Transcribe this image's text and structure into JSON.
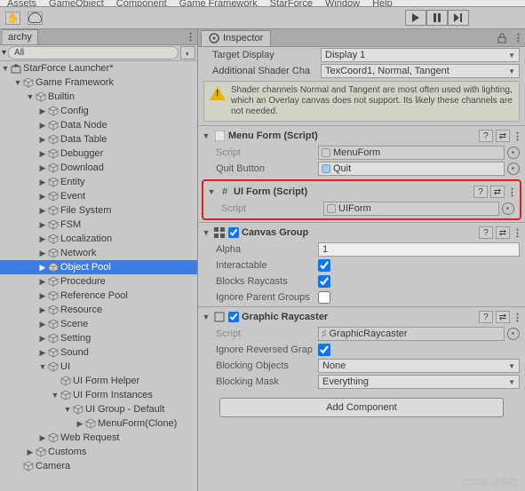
{
  "menubar": [
    "Assets",
    "GameObject",
    "Component",
    "Game Framework",
    "StarForce",
    "Window",
    "Help"
  ],
  "hierarchy": {
    "tab": "archy",
    "search": "All",
    "root": "StarForce Launcher*",
    "gf": "Game Framework",
    "builtin": "Builtin",
    "items": [
      "Config",
      "Data Node",
      "Data Table",
      "Debugger",
      "Download",
      "Entity",
      "Event",
      "File System",
      "FSM",
      "Localization",
      "Network",
      "Object Pool",
      "Procedure",
      "Reference Pool",
      "Resource",
      "Scene",
      "Setting",
      "Sound",
      "UI"
    ],
    "ui_children": [
      "UI Form Helper",
      "UI Form Instances"
    ],
    "ui_group": "UI Group - Default",
    "menu_clone": "MenuForm(Clone)",
    "last": "Web Request",
    "customs": "Customs",
    "camera": "Camera"
  },
  "inspector": {
    "tab": "Inspector",
    "td_label": "Target Display",
    "td_val": "Display 1",
    "asc_label": "Additional Shader Cha",
    "asc_val": "TexCoord1, Normal, Tangent",
    "warn": "Shader channels Normal and Tangent are most often used with lighting, which an Overlay canvas does not support. Its likely these channels are not needed.",
    "c_menu": {
      "title": "Menu Form (Script)",
      "script_l": "Script",
      "script_v": "MenuForm",
      "qb_l": "Quit Button",
      "qb_v": "Quit"
    },
    "c_ui": {
      "title": "UI Form (Script)",
      "script_l": "Script",
      "script_v": "UIForm"
    },
    "c_cg": {
      "title": "Canvas Group",
      "alpha_l": "Alpha",
      "alpha_v": "1",
      "int_l": "Interactable",
      "br_l": "Blocks Raycasts",
      "ig_l": "Ignore Parent Groups"
    },
    "c_gr": {
      "title": "Graphic Raycaster",
      "script_l": "Script",
      "script_v": "GraphicRaycaster",
      "irg_l": "Ignore Reversed Grap",
      "bo_l": "Blocking Objects",
      "bo_v": "None",
      "bm_l": "Blocking Mask",
      "bm_v": "Everything"
    },
    "add": "Add Component"
  },
  "wm": "CSDN @荒社"
}
